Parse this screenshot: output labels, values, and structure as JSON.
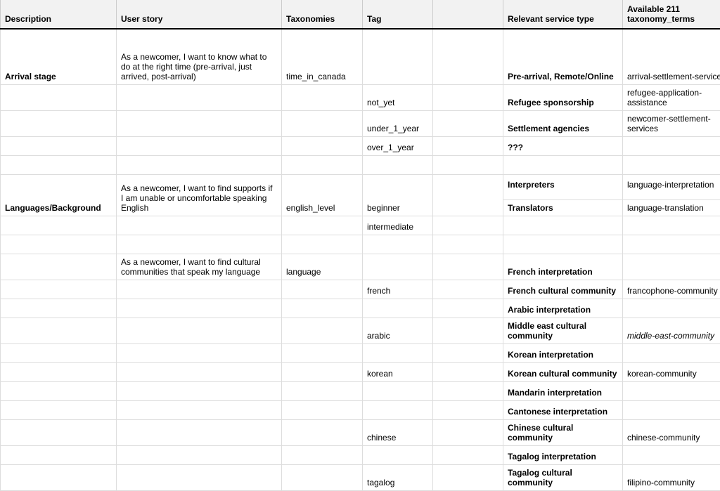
{
  "headers": {
    "description": "Description",
    "user_story": "User story",
    "taxonomies": "Taxonomies",
    "tag": "Tag",
    "blank": "",
    "relevant_service_type": "Relevant service type",
    "available_terms": "Available 211 taxonomy_terms"
  },
  "rows": [
    {
      "cls": "tall",
      "description": "Arrival stage",
      "descBold": true,
      "user_story": "As a newcomer, I want to know what to do at the right time (pre-arrival, just arrived, post-arrival)",
      "taxonomies": "time_in_canada",
      "tag": "",
      "col5": "",
      "service": "Pre-arrival, Remote/Online",
      "serviceBold": true,
      "terms": "arrival-settlement-services"
    },
    {
      "cls": "short",
      "description": "",
      "user_story": "",
      "taxonomies": "",
      "tag": "not_yet",
      "col5": "",
      "service": "Refugee sponsorship",
      "serviceBold": true,
      "terms": "refugee-application-assistance"
    },
    {
      "cls": "short",
      "description": "",
      "user_story": "",
      "taxonomies": "",
      "tag": "under_1_year",
      "col5": "",
      "service": "Settlement agencies",
      "serviceBold": true,
      "terms": "newcomer-settlement-services"
    },
    {
      "cls": "short",
      "description": "",
      "user_story": "",
      "taxonomies": "",
      "tag": "over_1_year",
      "col5": "",
      "service": "???",
      "serviceBold": true,
      "terms": ""
    },
    {
      "cls": "short",
      "description": "",
      "user_story": "",
      "taxonomies": "",
      "tag": "",
      "col5": "",
      "service": "",
      "terms": ""
    },
    {
      "cls": "med",
      "description": "Languages/Background",
      "descBold": true,
      "user_story": "As a newcomer, I want to find supports if I am unable or uncomfortable speaking English",
      "taxonomies": "english_level",
      "tag": "beginner",
      "col5": "",
      "serviceSplit": true,
      "service1": "Interpreters",
      "service2": "Translators",
      "terms1": "language-interpretation",
      "terms2": "language-translation"
    },
    {
      "cls": "short",
      "description": "",
      "user_story": "",
      "taxonomies": "",
      "tag": "intermediate",
      "col5": "",
      "service": "",
      "terms": ""
    },
    {
      "cls": "short",
      "description": "",
      "user_story": "",
      "taxonomies": "",
      "tag": "",
      "col5": "",
      "service": "",
      "terms": ""
    },
    {
      "cls": "short",
      "description": "",
      "user_story": "As a newcomer, I want to find cultural communities that speak my language",
      "taxonomies": "language",
      "tag": "",
      "col5": "",
      "service": "French interpretation",
      "serviceBold": true,
      "terms": ""
    },
    {
      "cls": "short",
      "description": "",
      "user_story": "",
      "taxonomies": "",
      "tag": "french",
      "col5": "",
      "service": "French cultural community",
      "serviceBold": true,
      "terms": "francophone-community"
    },
    {
      "cls": "short",
      "description": "",
      "user_story": "",
      "taxonomies": "",
      "tag": "",
      "col5": "",
      "service": "Arabic interpretation",
      "serviceBold": true,
      "terms": ""
    },
    {
      "cls": "short",
      "description": "",
      "user_story": "",
      "taxonomies": "",
      "tag": "arabic",
      "col5": "",
      "service": "Middle east cultural community",
      "serviceBold": true,
      "terms": "middle-east-community",
      "termsItalic": true
    },
    {
      "cls": "short",
      "description": "",
      "user_story": "",
      "taxonomies": "",
      "tag": "",
      "col5": "",
      "service": "Korean interpretation",
      "serviceBold": true,
      "terms": ""
    },
    {
      "cls": "short",
      "description": "",
      "user_story": "",
      "taxonomies": "",
      "tag": "korean",
      "col5": "",
      "service": "Korean cultural community",
      "serviceBold": true,
      "terms": "korean-community"
    },
    {
      "cls": "short",
      "description": "",
      "user_story": "",
      "taxonomies": "",
      "tag": "",
      "col5": "",
      "service": "Mandarin interpretation",
      "serviceBold": true,
      "terms": ""
    },
    {
      "cls": "short",
      "description": "",
      "user_story": "",
      "taxonomies": "",
      "tag": "",
      "col5": "",
      "service": "Cantonese interpretation",
      "serviceBold": true,
      "terms": ""
    },
    {
      "cls": "short",
      "description": "",
      "user_story": "",
      "taxonomies": "",
      "tag": "chinese",
      "col5": "",
      "service": "Chinese cultural community",
      "serviceBold": true,
      "terms": "chinese-community"
    },
    {
      "cls": "short",
      "description": "",
      "user_story": "",
      "taxonomies": "",
      "tag": "",
      "col5": "",
      "service": "Tagalog interpretation",
      "serviceBold": true,
      "terms": ""
    },
    {
      "cls": "short",
      "description": "",
      "user_story": "",
      "taxonomies": "",
      "tag": "tagalog",
      "col5": "",
      "service": "Tagalog cultural community",
      "serviceBold": true,
      "terms": "filipino-community"
    }
  ]
}
